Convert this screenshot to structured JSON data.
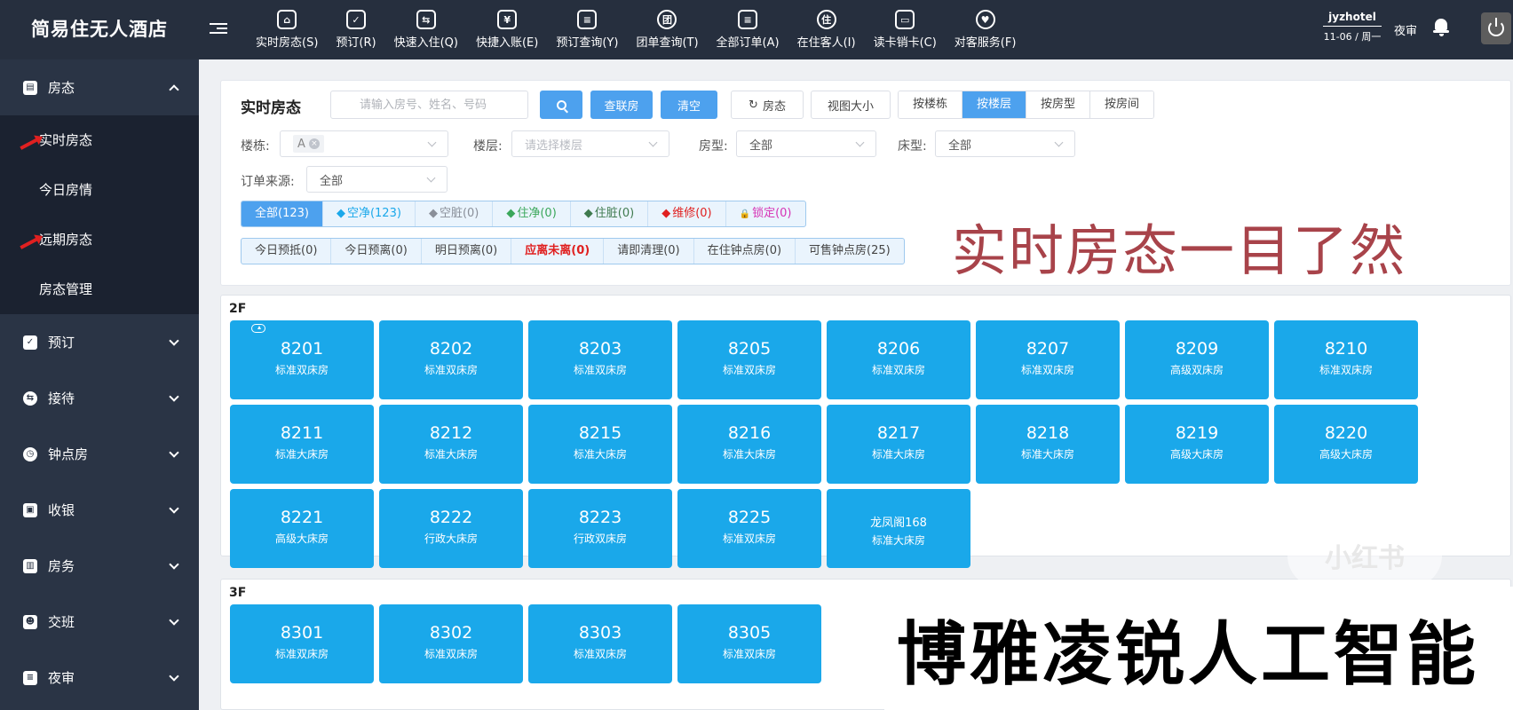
{
  "header": {
    "brand": "简易住无人酒店",
    "nav": [
      {
        "label": "实时房态(S)",
        "icon": "house-search-icon",
        "glyph": "⌂"
      },
      {
        "label": "预订(R)",
        "icon": "checkbox-icon",
        "glyph": "✓"
      },
      {
        "label": "快速入住(Q)",
        "icon": "handshake-icon",
        "glyph": "⇆"
      },
      {
        "label": "快捷入账(E)",
        "icon": "yen-icon",
        "glyph": "¥"
      },
      {
        "label": "预订查询(Y)",
        "icon": "doc-search-icon",
        "glyph": "≡"
      },
      {
        "label": "团单查询(T)",
        "icon": "group-icon",
        "glyph": "团"
      },
      {
        "label": "全部订单(A)",
        "icon": "order-list-icon",
        "glyph": "≡"
      },
      {
        "label": "在住客人(I)",
        "icon": "guest-icon",
        "glyph": "住"
      },
      {
        "label": "读卡销卡(C)",
        "icon": "card-icon",
        "glyph": "▭"
      },
      {
        "label": "对客服务(F)",
        "icon": "service-icon",
        "glyph": "♥"
      }
    ],
    "user_name": "jyzhotel",
    "date": "11-06 / 周一",
    "night_audit": "夜审"
  },
  "sidebar": {
    "groups": [
      {
        "label": "房态",
        "icon": "document-icon",
        "glyph": "▤",
        "expanded": true,
        "items": [
          "实时房态",
          "今日房情",
          "远期房态",
          "房态管理"
        ]
      },
      {
        "label": "预订",
        "icon": "checkbox-icon",
        "glyph": "✓"
      },
      {
        "label": "接待",
        "icon": "handshake-icon",
        "glyph": "⇆"
      },
      {
        "label": "钟点房",
        "icon": "clock-icon",
        "glyph": "◷"
      },
      {
        "label": "收银",
        "icon": "cashier-icon",
        "glyph": "▣"
      },
      {
        "label": "房务",
        "icon": "building-icon",
        "glyph": "▥"
      },
      {
        "label": "交班",
        "icon": "user-swap-icon",
        "glyph": "☻"
      },
      {
        "label": "夜审",
        "icon": "database-icon",
        "glyph": "≡"
      }
    ]
  },
  "filters": {
    "title": "实时房态",
    "search_placeholder": "请输入房号、姓名、号码",
    "btn_lianfang": "查联房",
    "btn_clear": "清空",
    "btn_room_status": "房态",
    "btn_view_size": "视图大小",
    "group_by": [
      "按楼栋",
      "按楼层",
      "按房型",
      "按房间"
    ],
    "group_by_active": 1,
    "building_label": "楼栋:",
    "building_tag": "A",
    "floor_label": "楼层:",
    "floor_placeholder": "请选择楼层",
    "room_type_label": "房型:",
    "room_type_value": "全部",
    "bed_type_label": "床型:",
    "bed_type_value": "全部",
    "order_source_label": "订单来源:",
    "order_source_value": "全部",
    "status_row1": [
      {
        "sym": "",
        "text": "全部(123)",
        "color": "#ffffff",
        "active": true
      },
      {
        "sym": "◆",
        "text": "空净(123)",
        "color": "#1aa8ea"
      },
      {
        "sym": "◆",
        "text": "空脏(0)",
        "color": "#8a8f99"
      },
      {
        "sym": "◆",
        "text": "住净(0)",
        "color": "#3aa75a"
      },
      {
        "sym": "◆",
        "text": "住脏(0)",
        "color": "#3f7a4e"
      },
      {
        "sym": "◆",
        "text": "维修(0)",
        "color": "#e02020"
      },
      {
        "sym": "🔒",
        "text": "锁定(0)",
        "color": "#d633b5"
      }
    ],
    "status_row2": [
      {
        "text": "今日预抵(0)"
      },
      {
        "text": "今日预离(0)"
      },
      {
        "text": "明日预离(0)"
      },
      {
        "text": "应离未离(0)",
        "red": true
      },
      {
        "text": "请即清理(0)"
      },
      {
        "text": "在住钟点房(0)"
      },
      {
        "text": "可售钟点房(25)"
      }
    ]
  },
  "overlay_text": "实时房态一目了然",
  "floors": [
    {
      "label": "2F",
      "rooms": [
        {
          "num": "8201",
          "type": "标准双床房"
        },
        {
          "num": "8202",
          "type": "标准双床房"
        },
        {
          "num": "8203",
          "type": "标准双床房"
        },
        {
          "num": "8205",
          "type": "标准双床房"
        },
        {
          "num": "8206",
          "type": "标准双床房"
        },
        {
          "num": "8207",
          "type": "标准双床房"
        },
        {
          "num": "8209",
          "type": "高级双床房"
        },
        {
          "num": "8210",
          "type": "标准双床房"
        },
        {
          "num": "8211",
          "type": "标准大床房"
        },
        {
          "num": "8212",
          "type": "标准大床房"
        },
        {
          "num": "8215",
          "type": "标准大床房"
        },
        {
          "num": "8216",
          "type": "标准大床房"
        },
        {
          "num": "8217",
          "type": "标准大床房"
        },
        {
          "num": "8218",
          "type": "标准大床房"
        },
        {
          "num": "8219",
          "type": "高级大床房"
        },
        {
          "num": "8220",
          "type": "高级大床房"
        },
        {
          "num": "8221",
          "type": "高级大床房"
        },
        {
          "num": "8222",
          "type": "行政大床房"
        },
        {
          "num": "8223",
          "type": "行政双床房"
        },
        {
          "num": "8225",
          "type": "标准双床房"
        },
        {
          "num": "龙凤阁168",
          "type": "标准大床房"
        }
      ]
    },
    {
      "label": "3F",
      "rooms": [
        {
          "num": "8301",
          "type": "标准双床房"
        },
        {
          "num": "8302",
          "type": "标准双床房"
        },
        {
          "num": "8303",
          "type": "标准双床房"
        },
        {
          "num": "8305",
          "type": "标准双床房"
        }
      ]
    }
  ],
  "bottom_overlay": "博雅凌锐人工智能",
  "watermark": "小红书"
}
